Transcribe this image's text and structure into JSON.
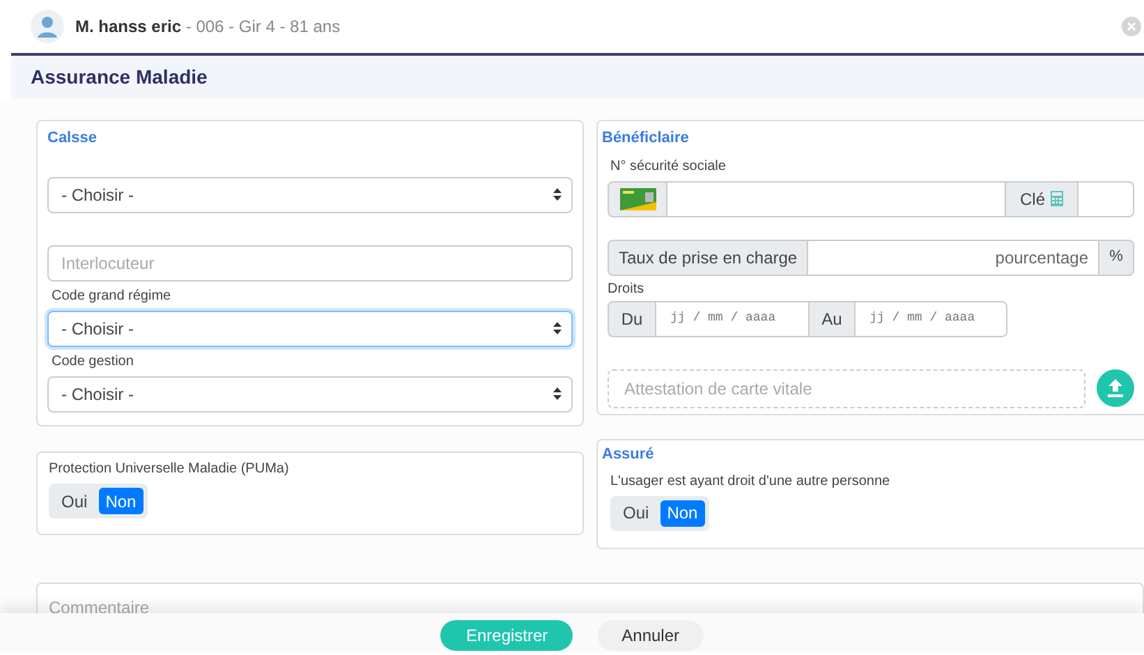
{
  "header": {
    "patient_name": "M. hanss eric",
    "patient_details": " - 006 - Gir 4 - 81 ans"
  },
  "title": "Assurance Maladie",
  "caisse": {
    "heading": "Calsse",
    "fields": [
      {
        "kind": "select",
        "value": "- Choisir -",
        "focused": false
      },
      {
        "kind": "text",
        "placeholder": "Interlocuteur"
      },
      {
        "kind": "select",
        "label": "Code grand régime",
        "value": "- Choisir -",
        "focused": true
      },
      {
        "kind": "select",
        "label": "Code gestion",
        "value": "- Choisir -",
        "focused": false
      }
    ]
  },
  "beneficiaire": {
    "heading": "Bénéficlaire",
    "ssn_label": "N° sécurité sociale",
    "cle_label": "Clé",
    "taux_label": "Taux de prise en charge",
    "taux_placeholder": "pourcentage",
    "taux_unit": "%",
    "droits_label": "Droits",
    "from_label": "Du",
    "from_placeholder": "jj / mm / aaaa",
    "to_label": "Au",
    "to_placeholder": "jj / mm / aaaa",
    "attestation_placeholder": "Attestation de carte vitale"
  },
  "puma": {
    "label": "Protection Universelle Maladie (PUMa)",
    "options": [
      {
        "label": "Oui",
        "selected": false
      },
      {
        "label": "Non",
        "selected": true
      }
    ]
  },
  "assure": {
    "heading": "Assuré",
    "label": "L'usager est ayant droit d'une autre personne",
    "options": [
      {
        "label": "Oui",
        "selected": false
      },
      {
        "label": "Non",
        "selected": true
      }
    ]
  },
  "comment": {
    "placeholder": "Commentaire"
  },
  "buttons": [
    {
      "label": "Enregistrer",
      "kind": "primary"
    },
    {
      "label": "Annuler",
      "kind": "secondary"
    }
  ]
}
